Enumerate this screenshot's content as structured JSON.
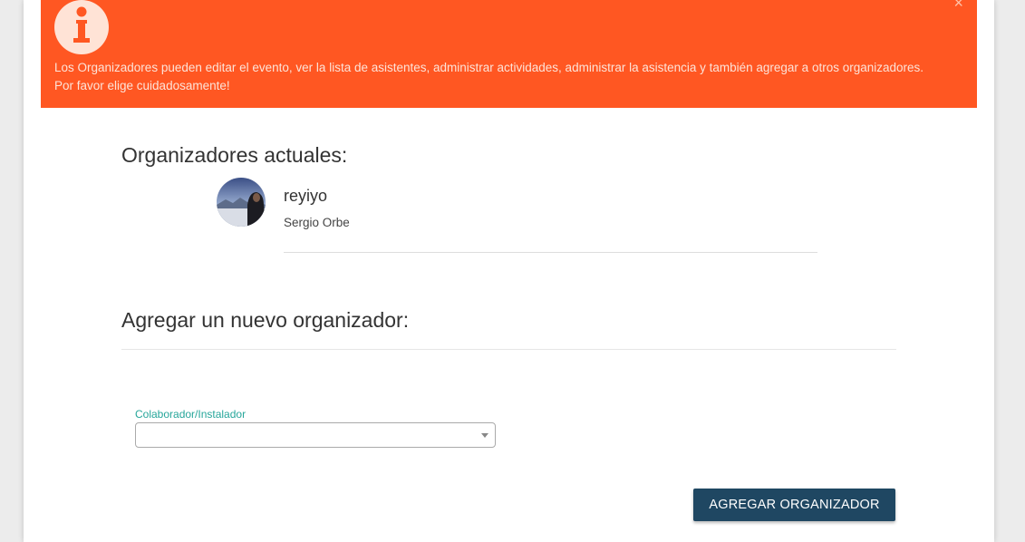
{
  "colors": {
    "alert_bg": "#ff5722",
    "button_bg": "#1f4762",
    "label_accent": "#26a69a"
  },
  "alert": {
    "icon": "info-icon",
    "close_label": "×",
    "line1": "Los Organizadores pueden editar el evento, ver la lista de asistentes, administrar actividades, administrar la asistencia y también agregar a otros organizadores.",
    "line2": "Por favor elige cuidadosamente!"
  },
  "current_organizers": {
    "heading": "Organizadores actuales:",
    "items": [
      {
        "username": "reyiyo",
        "full_name": "Sergio Orbe"
      }
    ]
  },
  "new_organizer": {
    "heading": "Agregar un nuevo organizador:",
    "field_label": "Colaborador/Instalador",
    "selected_value": "",
    "button_label": "AGREGAR ORGANIZADOR"
  }
}
